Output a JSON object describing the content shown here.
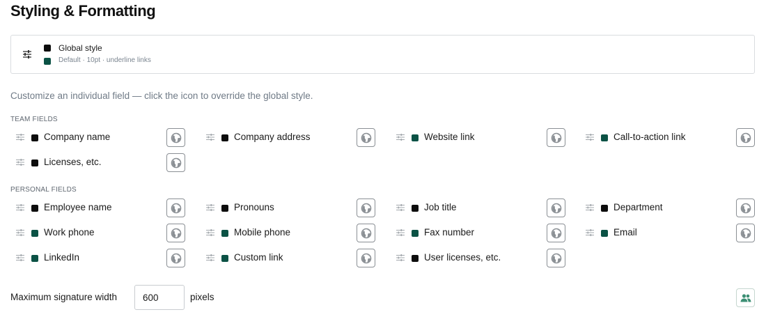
{
  "page": {
    "title": "Styling & Formatting"
  },
  "global_style": {
    "title": "Global style",
    "subtitle": "Default · 10pt · underline links"
  },
  "hint": "Customize an individual field — click the icon to override the global style.",
  "team_fields": {
    "label": "TEAM FIELDS",
    "items": [
      {
        "label": "Company name",
        "color": "#0d0d0d"
      },
      {
        "label": "Company address",
        "color": "#0d0d0d"
      },
      {
        "label": "Website link",
        "color": "#0b5245"
      },
      {
        "label": "Call-to-action link",
        "color": "#0b5245"
      },
      {
        "label": "Licenses, etc.",
        "color": "#0d0d0d"
      }
    ]
  },
  "personal_fields": {
    "label": "PERSONAL FIELDS",
    "items": [
      {
        "label": "Employee name",
        "color": "#0d0d0d"
      },
      {
        "label": "Pronouns",
        "color": "#0d0d0d"
      },
      {
        "label": "Job title",
        "color": "#0d0d0d"
      },
      {
        "label": "Department",
        "color": "#0d0d0d"
      },
      {
        "label": "Work phone",
        "color": "#0b5245"
      },
      {
        "label": "Mobile phone",
        "color": "#0b5245"
      },
      {
        "label": "Fax number",
        "color": "#0b5245"
      },
      {
        "label": "Email",
        "color": "#0b5245"
      },
      {
        "label": "LinkedIn",
        "color": "#0b5245"
      },
      {
        "label": "Custom link",
        "color": "#0b5245"
      },
      {
        "label": "User licenses, etc.",
        "color": "#0d0d0d"
      }
    ]
  },
  "max_width": {
    "label": "Maximum signature width",
    "value": "600",
    "unit": "pixels"
  },
  "icons": {
    "style": "sliders-icon",
    "override": "globe-icon",
    "people": "people-icon"
  }
}
